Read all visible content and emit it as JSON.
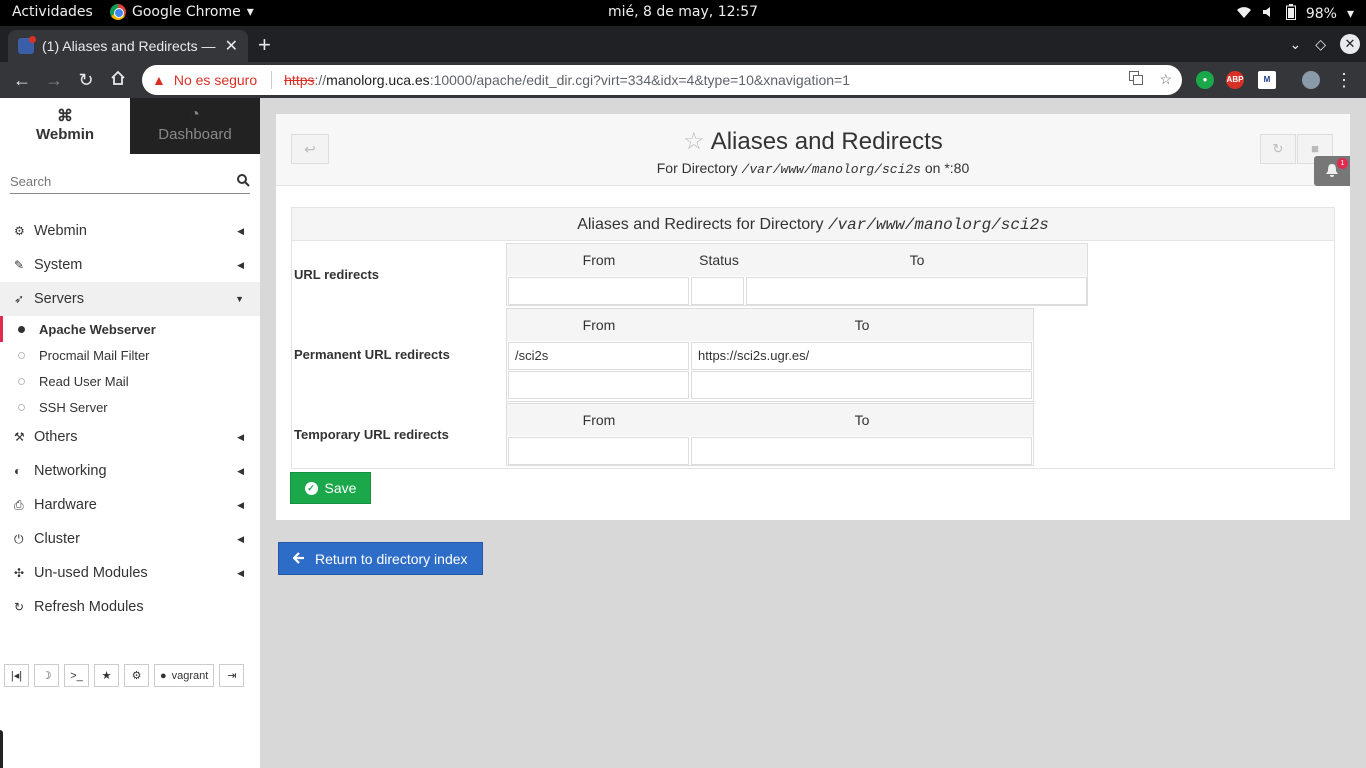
{
  "gnome": {
    "activities": "Actividades",
    "app": "Google Chrome",
    "clock": "mié,  8 de may, 12:57",
    "battery": "98%"
  },
  "browser": {
    "tab_title": "(1) Aliases and Redirects —",
    "insecure": "No es seguro",
    "url_scheme": "https",
    "url_sep": "://",
    "url_host": "manolorg.uca.es",
    "url_rest": ":10000/apache/edit_dir.cgi?virt=334&idx=4&type=10&xnavigation=1",
    "ext_abp": "ABP"
  },
  "sidebar": {
    "tab_webmin": "Webmin",
    "tab_dashboard": "Dashboard",
    "search_placeholder": "Search",
    "items": [
      {
        "label": "Webmin",
        "icon": "gear-icon"
      },
      {
        "label": "System",
        "icon": "wrench-icon"
      },
      {
        "label": "Servers",
        "icon": "rocket-icon"
      },
      {
        "label": "Others",
        "icon": "hammer-icon"
      },
      {
        "label": "Networking",
        "icon": "shield-icon"
      },
      {
        "label": "Hardware",
        "icon": "printer-icon"
      },
      {
        "label": "Cluster",
        "icon": "power-icon"
      },
      {
        "label": "Un-used Modules",
        "icon": "puzzle-icon"
      },
      {
        "label": "Refresh Modules",
        "icon": "refresh-icon"
      }
    ],
    "servers_sub": [
      "Apache Webserver",
      "Procmail Mail Filter",
      "Read User Mail",
      "SSH Server"
    ],
    "user": "vagrant"
  },
  "page": {
    "title": "Aliases and Redirects",
    "subtitle_prefix": "For Directory",
    "subtitle_path": "/var/www/manolorg/sci2s",
    "subtitle_suffix": "on *:80",
    "notification_count": "1",
    "box_title_prefix": "Aliases and Redirects for Directory",
    "box_title_path": "/var/www/manolorg/sci2s",
    "url_redirects": {
      "label": "URL redirects",
      "col_from": "From",
      "col_status": "Status",
      "col_to": "To"
    },
    "permanent": {
      "label": "Permanent URL redirects",
      "col_from": "From",
      "col_to": "To",
      "row1_from": "/sci2s",
      "row1_to": "https://sci2s.ugr.es/"
    },
    "temporary": {
      "label": "Temporary URL redirects",
      "col_from": "From",
      "col_to": "To"
    },
    "save_label": "Save",
    "return_label": "Return to directory index"
  }
}
